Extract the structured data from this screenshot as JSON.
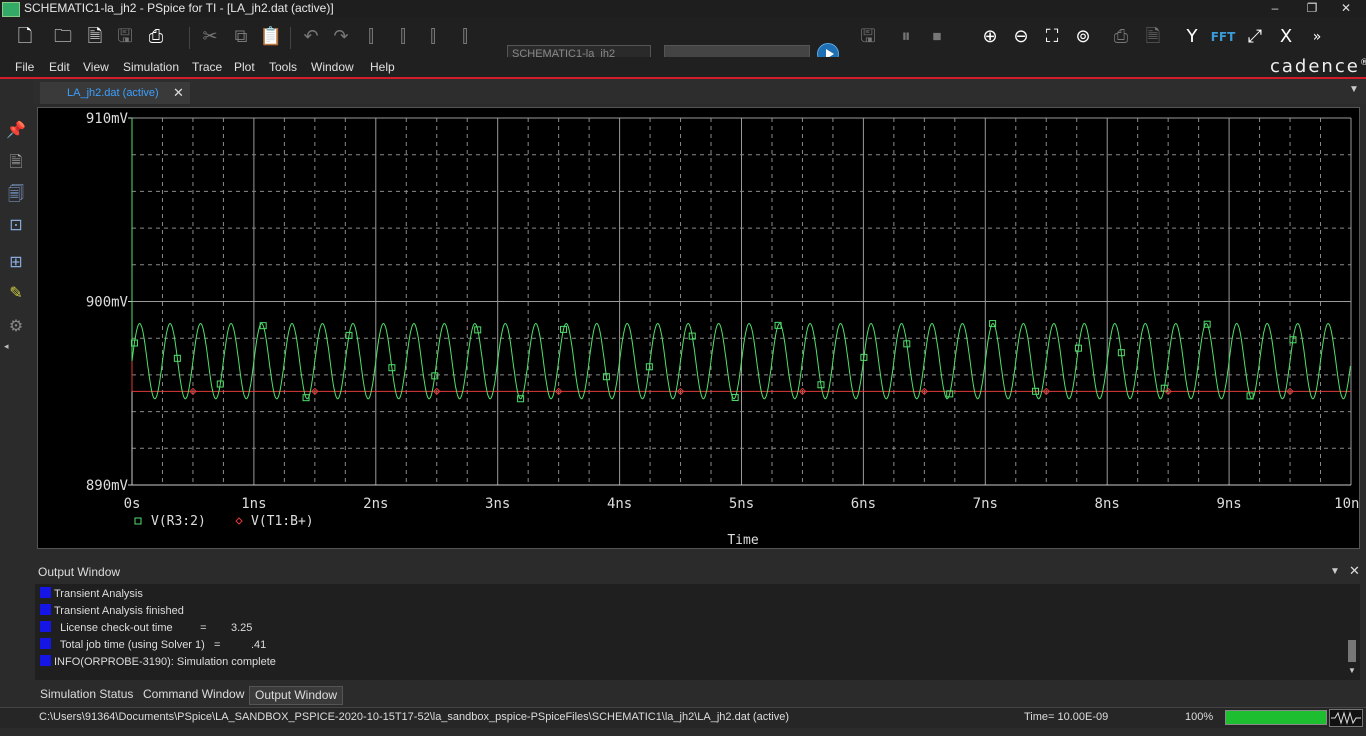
{
  "window": {
    "title": "SCHEMATIC1-la_jh2 - PSpice for TI - [LA_jh2.dat (active)]",
    "buttons": {
      "minimize": "–",
      "restore": "❐",
      "close": "✕"
    }
  },
  "toolbar": {
    "profile_value": "SCHEMATIC1-la_jh2",
    "fft_label": "FFT",
    "more_label": "»"
  },
  "menu": [
    "File",
    "Edit",
    "View",
    "Simulation",
    "Trace",
    "Plot",
    "Tools",
    "Window",
    "Help"
  ],
  "brand": "cadence",
  "brand_mark": "®",
  "document_tab": {
    "label": "LA_jh2.dat (active)",
    "close": "✕"
  },
  "chart_data": {
    "type": "line",
    "x_label": "Time",
    "x_ticks": [
      "0s",
      "1ns",
      "2ns",
      "3ns",
      "4ns",
      "5ns",
      "6ns",
      "7ns",
      "8ns",
      "9ns",
      "10ns"
    ],
    "xlim_ns": [
      0,
      10
    ],
    "y_ticks": [
      "910mV",
      "900mV",
      "890mV"
    ],
    "ylim_mV": [
      890,
      910
    ],
    "grid": true,
    "series": [
      {
        "name": "V(R3:2)",
        "color": "#4fe06a",
        "marker": "square",
        "shape": "sinusoid",
        "period_ns": 0.25,
        "max_mV": 898.8,
        "min_mV": 894.7,
        "start_mV": 910
      },
      {
        "name": "V(T1:B+)",
        "color": "#e03a3a",
        "marker": "diamond",
        "shape": "constant",
        "value_mV": 895.1
      }
    ],
    "legend_position": "bottom-left"
  },
  "output": {
    "title": "Output Window",
    "lines": [
      "Transient Analysis",
      "Transient Analysis finished",
      "  License check-out time         =        3.25",
      "  Total job time (using Solver 1)   =          .41",
      "INFO(ORPROBE-3190): Simulation complete"
    ]
  },
  "bottom_tabs": [
    "Simulation Status",
    "Command Window",
    "Output Window"
  ],
  "status": {
    "path": "C:\\Users\\91364\\Documents\\PSpice\\LA_SANDBOX_PSPICE-2020-10-15T17-52\\la_sandbox_pspice-PSpiceFiles\\SCHEMATIC1\\la_jh2\\LA_jh2.dat (active)",
    "time": "Time= 10.00E-09",
    "zoom": "100%",
    "progress": 1.0
  }
}
